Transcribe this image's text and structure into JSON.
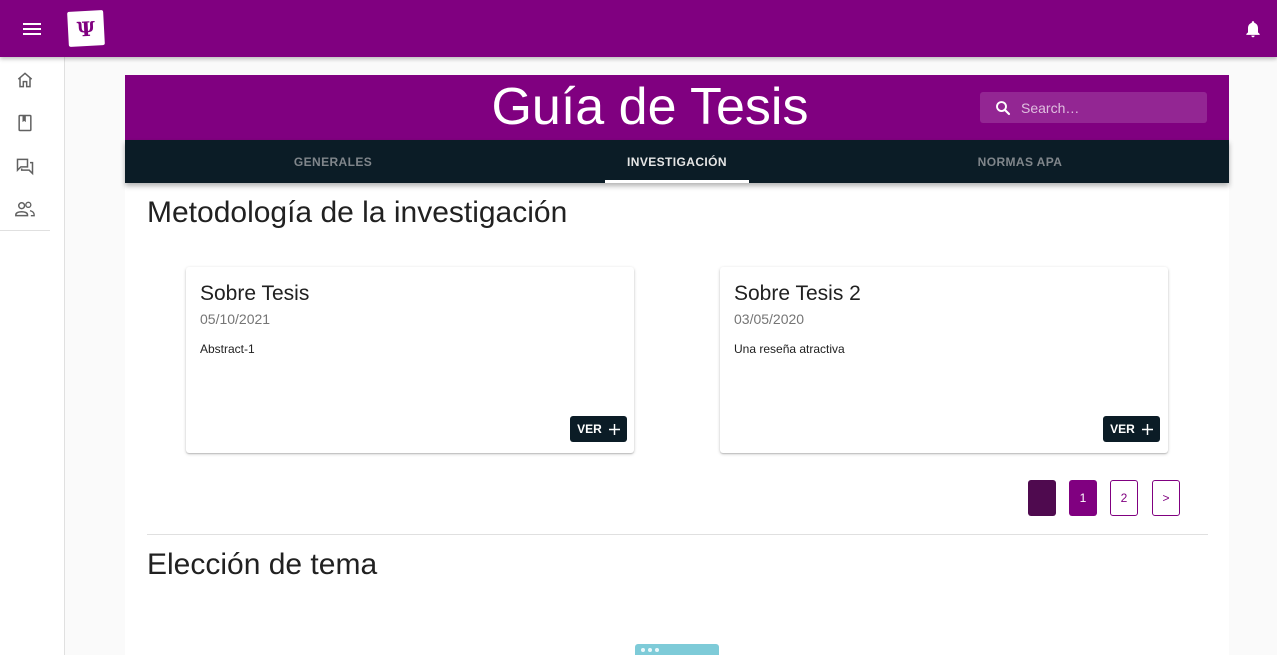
{
  "appbar": {
    "logo_text": "Ψ",
    "logo_icon": "psi-logo",
    "menu_icon": "hamburger-menu-icon",
    "bell_icon": "notification-bell-icon",
    "color": "#800080"
  },
  "sidebar": {
    "items": [
      {
        "icon": "home-icon"
      },
      {
        "icon": "book-icon"
      },
      {
        "icon": "forum-icon"
      },
      {
        "icon": "people-icon"
      }
    ]
  },
  "banner": {
    "title": "Guía de Tesis",
    "search_placeholder": "Search…"
  },
  "tabs": [
    {
      "label": "GENERALES",
      "active": false
    },
    {
      "label": "INVESTIGACIÓN",
      "active": true
    },
    {
      "label": "NORMAS APA",
      "active": false
    }
  ],
  "sections": [
    {
      "title": "Metodología de la investigación",
      "cards": [
        {
          "title": "Sobre Tesis",
          "date": "05/10/2021",
          "abstract": "Abstract-1",
          "button": "VER"
        },
        {
          "title": "Sobre Tesis 2",
          "date": "03/05/2020",
          "abstract": "Una reseña atractiva",
          "button": "VER"
        }
      ],
      "pagination": {
        "pages": [
          "1",
          "2"
        ],
        "next": ">",
        "current": "1"
      }
    },
    {
      "title": "Elección de tema"
    }
  ],
  "colors": {
    "primary": "#800080",
    "tab_bar": "#0b1c26",
    "illustration": "#7ecbd8"
  }
}
